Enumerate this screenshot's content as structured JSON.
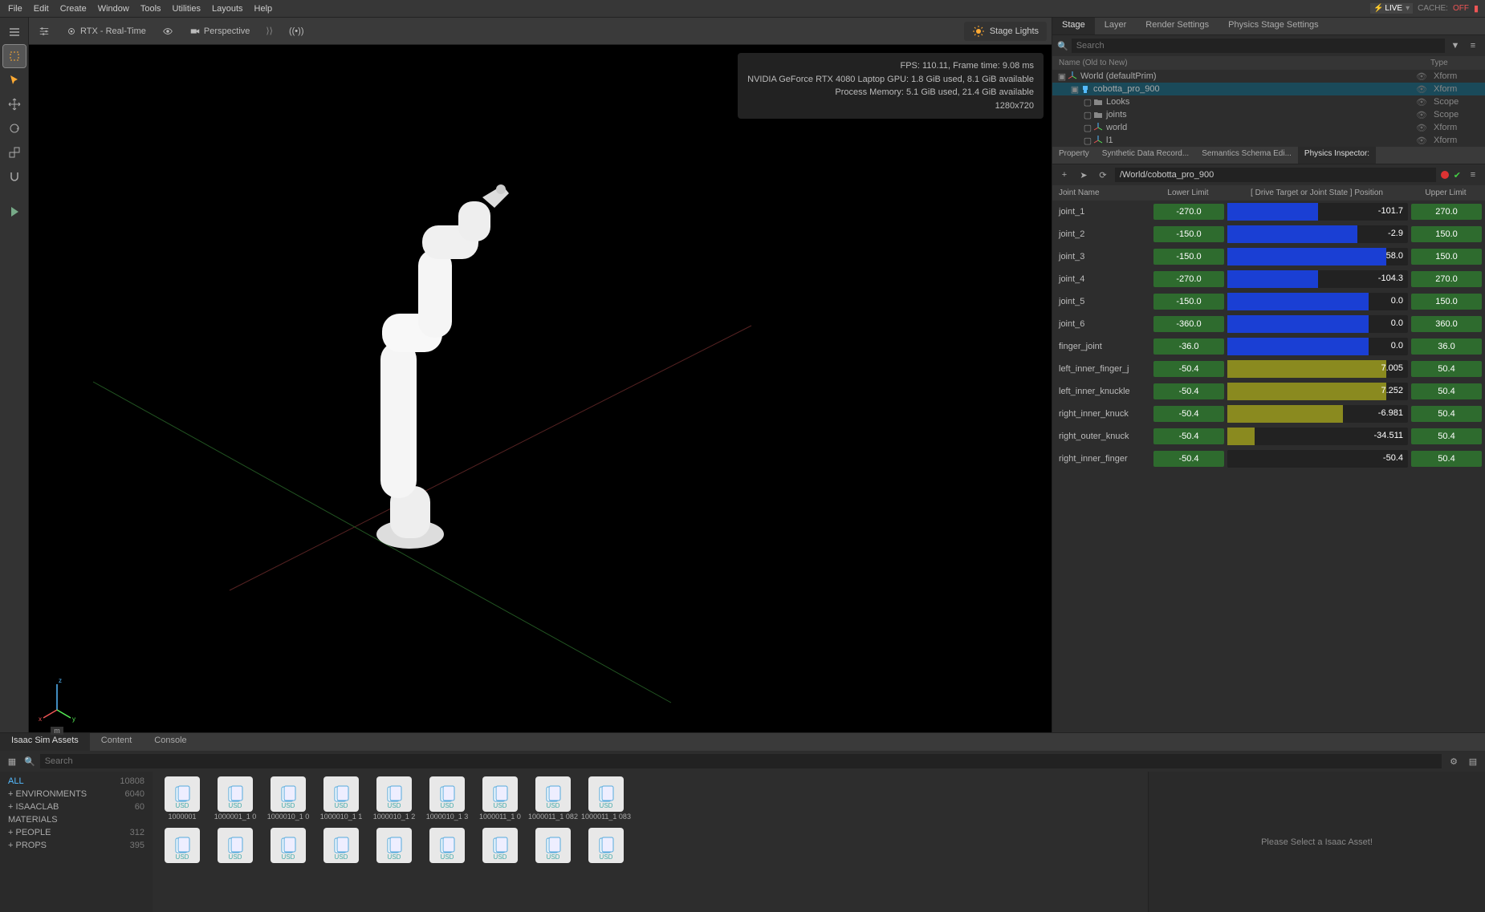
{
  "menubar": {
    "items": [
      "File",
      "Edit",
      "Create",
      "Window",
      "Tools",
      "Utilities",
      "Layouts",
      "Help"
    ],
    "live": "LIVE",
    "cache_label": "CACHE:",
    "cache_value": "OFF"
  },
  "viewport": {
    "renderer": "RTX - Real-Time",
    "camera": "Perspective",
    "stage_lights": "Stage Lights",
    "stats": {
      "l1": "FPS: 110.11, Frame time: 9.08 ms",
      "l2": "NVIDIA GeForce RTX 4080 Laptop GPU: 1.8 GiB used, 8.1 GiB available",
      "l3": "Process Memory: 5.1 GiB used, 21.4 GiB available",
      "l4": "1280x720"
    },
    "axis": {
      "x": "x",
      "y": "y",
      "z": "z",
      "unit": "m"
    }
  },
  "stage_tabs": [
    "Stage",
    "Layer",
    "Render Settings",
    "Physics Stage Settings"
  ],
  "stage": {
    "search_placeholder": "Search",
    "hdr": {
      "name": "Name (Old to New)",
      "type": "Type"
    },
    "tree": [
      {
        "indent": 0,
        "expand": "▣",
        "icon": "axes",
        "label": "World (defaultPrim)",
        "type": "Xform"
      },
      {
        "indent": 1,
        "expand": "▣",
        "icon": "robot",
        "label": "cobotta_pro_900",
        "type": "Xform",
        "sel": true
      },
      {
        "indent": 2,
        "expand": "▢",
        "icon": "folder",
        "label": "Looks",
        "type": "Scope"
      },
      {
        "indent": 2,
        "expand": "▢",
        "icon": "folder",
        "label": "joints",
        "type": "Scope"
      },
      {
        "indent": 2,
        "expand": "▢",
        "icon": "axes",
        "label": "world",
        "type": "Xform"
      },
      {
        "indent": 2,
        "expand": "▢",
        "icon": "axes",
        "label": "l1",
        "type": "Xform"
      }
    ]
  },
  "prop_tabs": [
    "Property",
    "Synthetic Data Record...",
    "Semantics Schema Edi...",
    "Physics Inspector:"
  ],
  "inspector": {
    "path": "/World/cobotta_pro_900",
    "hdr": {
      "c1": "Joint Name",
      "c2": "Lower Limit",
      "c3": "[ Drive Target or Joint State ] Position",
      "c4": "Upper Limit"
    },
    "joints": [
      {
        "name": "joint_1",
        "low": "-270.0",
        "val": "-101.7",
        "up": "270.0",
        "fill": [
          0,
          50
        ],
        "color": "blue"
      },
      {
        "name": "joint_2",
        "low": "-150.0",
        "val": "-2.9",
        "up": "150.0",
        "fill": [
          0,
          72
        ],
        "color": "blue"
      },
      {
        "name": "joint_3",
        "low": "-150.0",
        "val": "58.0",
        "up": "150.0",
        "fill": [
          0,
          88
        ],
        "color": "blue"
      },
      {
        "name": "joint_4",
        "low": "-270.0",
        "val": "-104.3",
        "up": "270.0",
        "fill": [
          0,
          50
        ],
        "color": "blue"
      },
      {
        "name": "joint_5",
        "low": "-150.0",
        "val": "0.0",
        "up": "150.0",
        "fill": [
          0,
          78
        ],
        "color": "blue"
      },
      {
        "name": "joint_6",
        "low": "-360.0",
        "val": "0.0",
        "up": "360.0",
        "fill": [
          0,
          78
        ],
        "color": "blue"
      },
      {
        "name": "finger_joint",
        "low": "-36.0",
        "val": "0.0",
        "up": "36.0",
        "fill": [
          0,
          78
        ],
        "color": "blue"
      },
      {
        "name": "left_inner_finger_j",
        "low": "-50.4",
        "val": "7.005",
        "up": "50.4",
        "fill": [
          0,
          88
        ],
        "color": "olive"
      },
      {
        "name": "left_inner_knuckle",
        "low": "-50.4",
        "val": "7.252",
        "up": "50.4",
        "fill": [
          0,
          88
        ],
        "color": "olive"
      },
      {
        "name": "right_inner_knuck",
        "low": "-50.4",
        "val": "-6.981",
        "up": "50.4",
        "fill": [
          0,
          64
        ],
        "color": "olive"
      },
      {
        "name": "right_outer_knuck",
        "low": "-50.4",
        "val": "-34.511",
        "up": "50.4",
        "fill": [
          0,
          15
        ],
        "color": "olive"
      },
      {
        "name": "right_inner_finger",
        "low": "-50.4",
        "val": "-50.4",
        "up": "50.4",
        "fill": [
          0,
          0
        ],
        "color": "olive"
      }
    ]
  },
  "bottom_tabs": [
    "Isaac Sim Assets",
    "Content",
    "Console"
  ],
  "assets": {
    "search_placeholder": "Search",
    "cats": [
      {
        "label": "ALL",
        "count": "10808",
        "all": true
      },
      {
        "label": "+ ENVIRONMENTS",
        "count": "6040"
      },
      {
        "label": "+ ISAACLAB",
        "count": "60"
      },
      {
        "label": "   MATERIALS",
        "count": ""
      },
      {
        "label": "+ PEOPLE",
        "count": "312"
      },
      {
        "label": "+ PROPS",
        "count": "395"
      }
    ],
    "items": [
      "1000001",
      "1000001_1 0",
      "1000010_1 0",
      "1000010_1 1",
      "1000010_1 2",
      "1000010_1 3",
      "1000011_1 0",
      "1000011_1 082",
      "1000011_1 083"
    ],
    "detail_msg": "Please Select a Isaac Asset!"
  }
}
